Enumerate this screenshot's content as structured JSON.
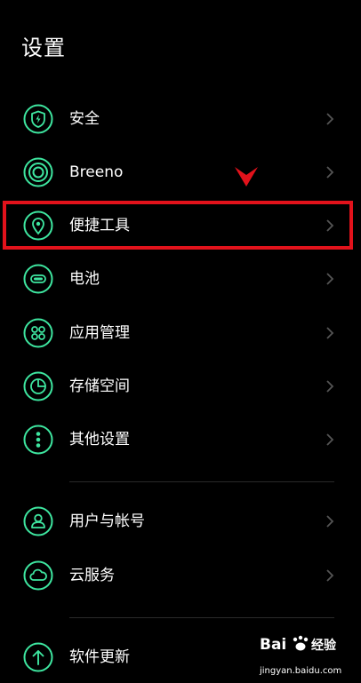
{
  "header": {
    "title": "设置"
  },
  "colors": {
    "accent": "#3ee6a0",
    "background": "#000000",
    "text": "#ffffff",
    "chevron": "#555555",
    "divider": "#2a2a2a",
    "annotation": "#e2121b"
  },
  "settings": {
    "items": [
      {
        "label": "安全",
        "icon": "shield-lightning-icon"
      },
      {
        "label": "Breeno",
        "icon": "breeno-rings-icon"
      },
      {
        "label": "便捷工具",
        "icon": "location-pin-icon"
      },
      {
        "label": "电池",
        "icon": "battery-icon"
      },
      {
        "label": "应用管理",
        "icon": "apps-grid-icon"
      },
      {
        "label": "存储空间",
        "icon": "pie-chart-icon"
      },
      {
        "label": "其他设置",
        "icon": "more-dots-icon"
      },
      {
        "label": "用户与帐号",
        "icon": "user-icon"
      },
      {
        "label": "云服务",
        "icon": "cloud-icon"
      },
      {
        "label": "软件更新",
        "icon": "update-arrow-icon"
      }
    ]
  },
  "annotation": {
    "highlighted_item": "便捷工具",
    "marker": "red-check-arrow"
  },
  "watermark": {
    "logo_text": "Bai 经验",
    "url": "jingyan.baidu.com"
  }
}
